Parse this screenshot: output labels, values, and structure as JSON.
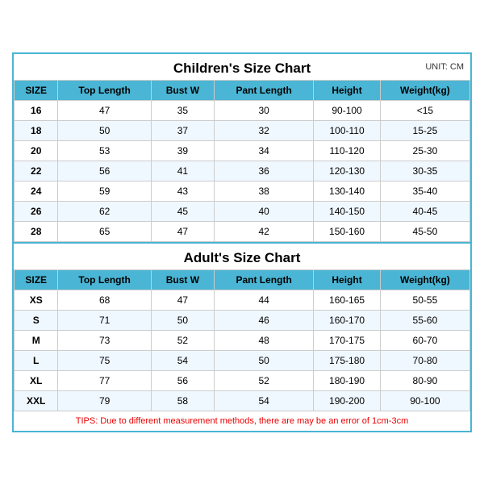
{
  "children_chart": {
    "title": "Children's Size Chart",
    "unit": "UNIT: CM",
    "headers": [
      "SIZE",
      "Top Length",
      "Bust W",
      "Pant Length",
      "Height",
      "Weight(kg)"
    ],
    "rows": [
      [
        "16",
        "47",
        "35",
        "30",
        "90-100",
        "<15"
      ],
      [
        "18",
        "50",
        "37",
        "32",
        "100-110",
        "15-25"
      ],
      [
        "20",
        "53",
        "39",
        "34",
        "110-120",
        "25-30"
      ],
      [
        "22",
        "56",
        "41",
        "36",
        "120-130",
        "30-35"
      ],
      [
        "24",
        "59",
        "43",
        "38",
        "130-140",
        "35-40"
      ],
      [
        "26",
        "62",
        "45",
        "40",
        "140-150",
        "40-45"
      ],
      [
        "28",
        "65",
        "47",
        "42",
        "150-160",
        "45-50"
      ]
    ]
  },
  "adults_chart": {
    "title": "Adult's Size Chart",
    "headers": [
      "SIZE",
      "Top Length",
      "Bust W",
      "Pant Length",
      "Height",
      "Weight(kg)"
    ],
    "rows": [
      [
        "XS",
        "68",
        "47",
        "44",
        "160-165",
        "50-55"
      ],
      [
        "S",
        "71",
        "50",
        "46",
        "160-170",
        "55-60"
      ],
      [
        "M",
        "73",
        "52",
        "48",
        "170-175",
        "60-70"
      ],
      [
        "L",
        "75",
        "54",
        "50",
        "175-180",
        "70-80"
      ],
      [
        "XL",
        "77",
        "56",
        "52",
        "180-190",
        "80-90"
      ],
      [
        "XXL",
        "79",
        "58",
        "54",
        "190-200",
        "90-100"
      ]
    ]
  },
  "tips": "TIPS: Due to different measurement methods, there are may be an error of 1cm-3cm"
}
